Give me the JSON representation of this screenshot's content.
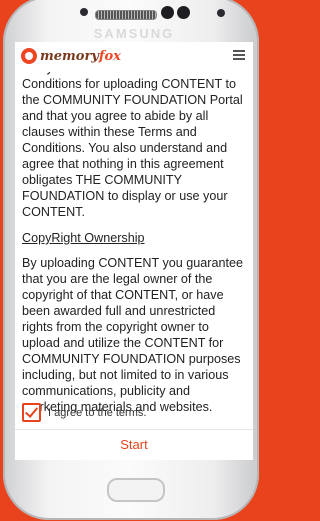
{
  "device": {
    "brand": "SAMSUNG"
  },
  "app": {
    "logo_prefix": "memory",
    "logo_suffix": "fox"
  },
  "terms": {
    "cut_line": "that you have read these Terms and",
    "paragraph1": "Conditions for uploading CONTENT to the COMMUNITY FOUNDATION  Portal and that you agree to abide by all clauses within these Terms and Conditions. You also understand and agree that nothing in this agreement obligates THE COMMUNITY FOUNDATION to display or use your CONTENT.",
    "heading": "CopyRight Ownership",
    "paragraph2": "By uploading CONTENT you guarantee that you are the legal owner of the copyright of that CONTENT, or have been awarded full and unrestricted rights from the copyright owner to upload and utilize the CONTENT for COMMUNITY FOUNDATION purposes including, but not limited to in various communications, publicity and marketing materials and websites."
  },
  "agreement": {
    "label": "I agree to the terms.",
    "checked": true
  },
  "actions": {
    "start_label": "Start"
  },
  "colors": {
    "accent": "#e8431c",
    "background": "#e8431c"
  }
}
